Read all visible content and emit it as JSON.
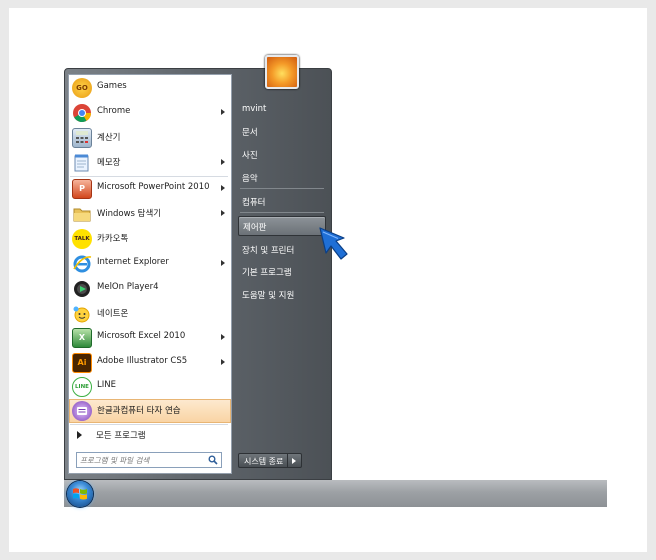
{
  "start_menu": {
    "programs": [
      {
        "label": "Games",
        "icon": "games-icon",
        "arrow": false
      },
      {
        "label": "Chrome",
        "icon": "chrome-icon",
        "arrow": true
      },
      {
        "label": "계산기",
        "icon": "calculator-icon",
        "arrow": false
      },
      {
        "label": "메모장",
        "icon": "notepad-icon",
        "arrow": true
      },
      {
        "label": "Microsoft PowerPoint 2010",
        "icon": "powerpoint-icon",
        "arrow": true
      },
      {
        "label": "Windows 탐색기",
        "icon": "explorer-folder-icon",
        "arrow": true
      },
      {
        "label": "카카오톡",
        "icon": "kakaotalk-icon",
        "arrow": false
      },
      {
        "label": "Internet Explorer",
        "icon": "internet-explorer-icon",
        "arrow": true
      },
      {
        "label": "MelOn Player4",
        "icon": "melon-icon",
        "arrow": false
      },
      {
        "label": "네이트온",
        "icon": "nateon-icon",
        "arrow": false
      },
      {
        "label": "Microsoft Excel 2010",
        "icon": "excel-icon",
        "arrow": true
      },
      {
        "label": "Adobe Illustrator CS5",
        "icon": "illustrator-icon",
        "arrow": true
      },
      {
        "label": "LINE",
        "icon": "line-icon",
        "arrow": false
      },
      {
        "label": "한글과컴퓨터 타자 연습",
        "icon": "hancom-typing-icon",
        "arrow": false,
        "highlighted": true
      }
    ],
    "all_programs_label": "모든 프로그램",
    "search_placeholder": "프로그램 및 파일 검색",
    "icon_text": {
      "games": "GO",
      "kakaotalk": "TALK",
      "powerpoint": "P",
      "excel": "X",
      "illustrator": "Ai",
      "line": "LINE"
    }
  },
  "right_pane": {
    "links": [
      {
        "label": "mvint"
      },
      {
        "label": "문서"
      },
      {
        "label": "사진"
      },
      {
        "label": "음악"
      },
      {
        "label": "컴퓨터"
      },
      {
        "label": "제어판",
        "highlighted": true
      },
      {
        "label": "장치 및 프린터"
      },
      {
        "label": "기본 프로그램"
      },
      {
        "label": "도움말 및 지원"
      }
    ],
    "shutdown_label": "시스템 종료"
  },
  "colors": {
    "highlight_left": "#f9d4a4",
    "menu_dark": "#5d6369",
    "cursor_blue": "#1f6fd6"
  }
}
